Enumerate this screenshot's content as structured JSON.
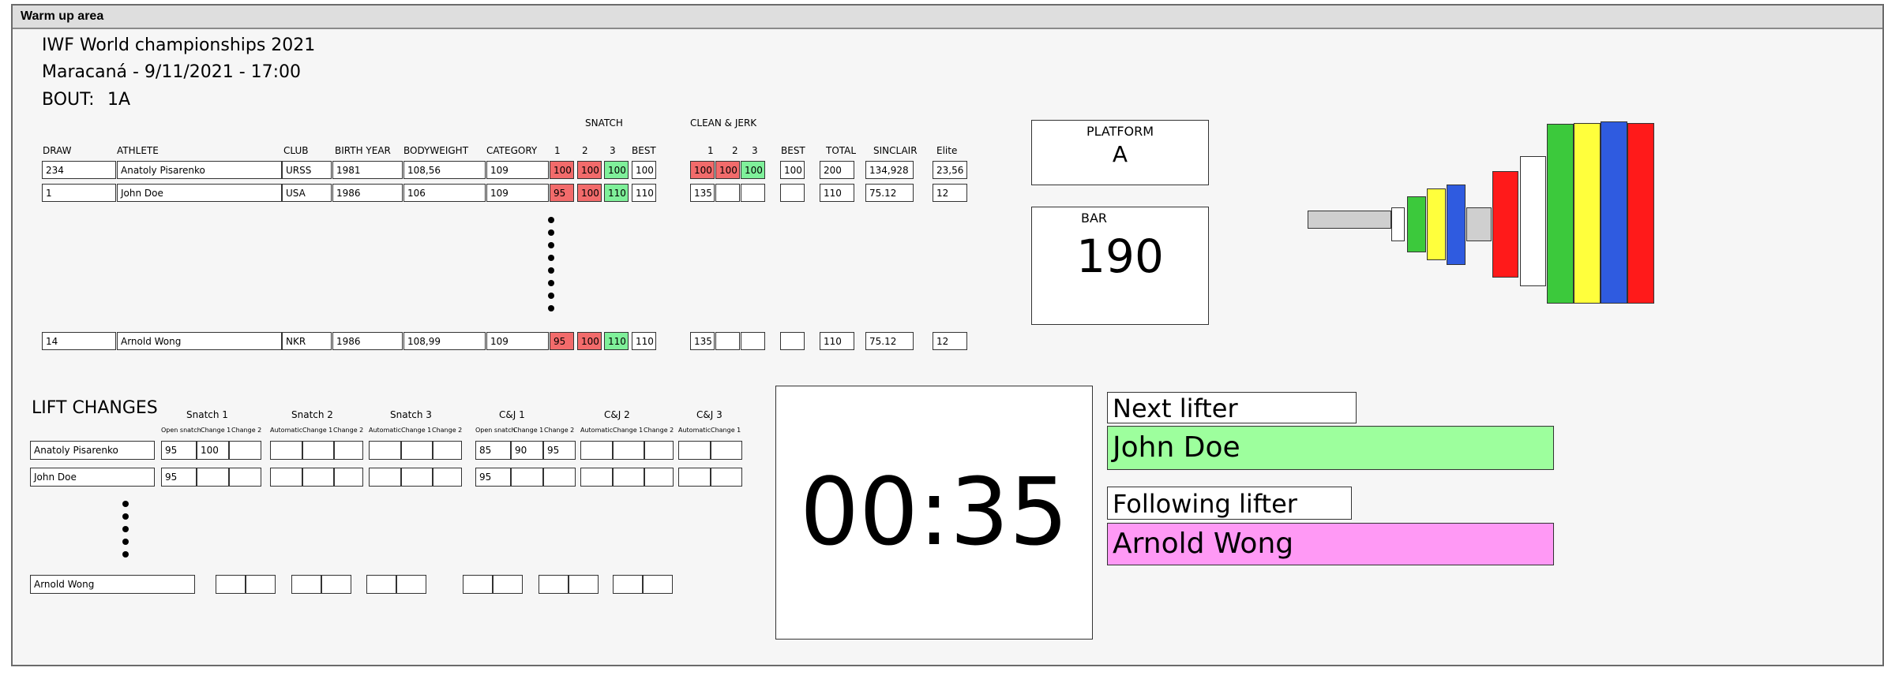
{
  "window": {
    "title": "Warm up area"
  },
  "event": {
    "title": "IWF World championships 2021",
    "venue_line": "Maracaná - 9/11/2021 - 17:00",
    "bout_label": "BOUT:",
    "bout_value": "1A"
  },
  "results": {
    "group_headers": {
      "snatch": "SNATCH",
      "cj": "CLEAN & JERK"
    },
    "columns": {
      "draw": "DRAW",
      "athlete": "ATHLETE",
      "club": "CLUB",
      "birth": "BIRTH YEAR",
      "bodyweight": "BODYWEIGHT",
      "category": "CATEGORY",
      "s1": "1",
      "s2": "2",
      "s3": "3",
      "sbest": "BEST",
      "c1": "1",
      "c2": "2",
      "c3": "3",
      "cbest": "BEST",
      "total": "TOTAL",
      "sinclair": "SINCLAIR",
      "elite": "Elite"
    },
    "rows": [
      {
        "draw": "234",
        "athlete": "Anatoly Pisarenko",
        "club": "URSS",
        "birth": "1981",
        "bodyweight": "108,56",
        "category": "109",
        "s1": "100",
        "s2": "100",
        "s3": "100",
        "sbest": "100",
        "c1": "100",
        "c2": "100",
        "c3": "100",
        "cbest": "100",
        "total": "200",
        "sinclair": "134,928",
        "elite": "23,56"
      },
      {
        "draw": "1",
        "athlete": "John Doe",
        "club": "USA",
        "birth": "1986",
        "bodyweight": "106",
        "category": "109",
        "s1": "95",
        "s2": "100",
        "s3": "110",
        "sbest": "110",
        "c1": "135",
        "c2": "",
        "c3": "",
        "cbest": "",
        "total": "110",
        "sinclair": "75.12",
        "elite": "12"
      },
      {
        "draw": "14",
        "athlete": "Arnold Wong",
        "club": "NKR",
        "birth": "1986",
        "bodyweight": "108,99",
        "category": "109",
        "s1": "95",
        "s2": "100",
        "s3": "110",
        "sbest": "110",
        "c1": "135",
        "c2": "",
        "c3": "",
        "cbest": "",
        "total": "110",
        "sinclair": "75.12",
        "elite": "12"
      }
    ],
    "colors": {
      "fail": "#f26b6b",
      "good": "#7ff09a"
    }
  },
  "platform": {
    "label": "PLATFORM",
    "value": "A"
  },
  "bar": {
    "label": "BAR",
    "value": "190"
  },
  "barbell_plate_colors": [
    "#3cc93c",
    "#ffff3c",
    "#2f5be0",
    "#ff1a1a"
  ],
  "lift_changes": {
    "title": "LIFT CHANGES",
    "groups": {
      "snatch1": {
        "label": "Snatch 1",
        "sub": [
          "Open snatch",
          "Change 1",
          "Change 2"
        ]
      },
      "snatch2": {
        "label": "Snatch 2",
        "sub": [
          "Automatic",
          "Change 1",
          "Change 2"
        ]
      },
      "snatch3": {
        "label": "Snatch 3",
        "sub": [
          "Automatic",
          "Change 1",
          "Change 2"
        ]
      },
      "cj1": {
        "label": "C&J 1",
        "sub": [
          "Open snatch",
          "Change 1",
          "Change 2"
        ]
      },
      "cj2": {
        "label": "C&J 2",
        "sub": [
          "Automatic",
          "Change 1",
          "Change 2"
        ]
      },
      "cj3": {
        "label": "C&J 3",
        "sub": [
          "Automatic",
          "Change 1"
        ]
      }
    },
    "rows": [
      {
        "athlete": "Anatoly Pisarenko",
        "s1": [
          "95",
          "100",
          ""
        ],
        "cj1": [
          "85",
          "90",
          "95"
        ]
      },
      {
        "athlete": "John Doe",
        "s1": [
          "95",
          "",
          ""
        ],
        "cj1": [
          "95",
          "",
          ""
        ]
      },
      {
        "athlete": "Arnold Wong"
      }
    ]
  },
  "timer": {
    "value": "00:35"
  },
  "next": {
    "label": "Next lifter",
    "name": "John Doe",
    "color": "#9dff9d"
  },
  "following": {
    "label": "Following lifter",
    "name": "Arnold Wong",
    "color": "#ff99f5"
  }
}
